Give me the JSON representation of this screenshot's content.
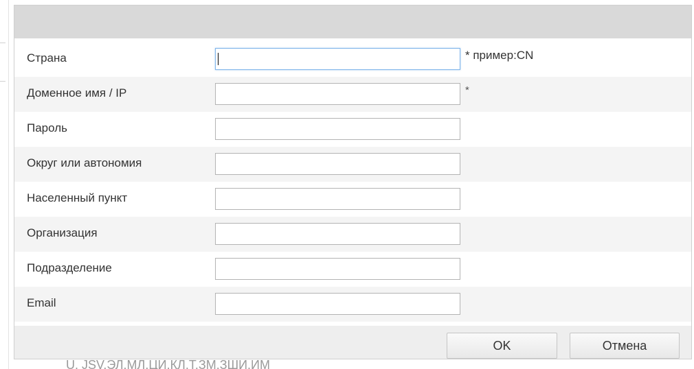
{
  "background": {
    "partial_text": "U. JSV.ЭЛ.МЛ.ЦИ.КЛ.Т.ЗМ.ЗШИ.ИМ"
  },
  "dialog": {
    "fields": [
      {
        "label": "Страна",
        "value": "",
        "note": "* пример:CN",
        "focused": true
      },
      {
        "label": "Доменное имя / IP",
        "value": "",
        "note": "*"
      },
      {
        "label": "Пароль",
        "value": "",
        "note": ""
      },
      {
        "label": "Округ или автономия",
        "value": "",
        "note": ""
      },
      {
        "label": "Населенный пункт",
        "value": "",
        "note": ""
      },
      {
        "label": "Организация",
        "value": "",
        "note": ""
      },
      {
        "label": "Подразделение",
        "value": "",
        "note": ""
      },
      {
        "label": "Email",
        "value": "",
        "note": ""
      }
    ],
    "buttons": {
      "ok_label": "OK",
      "cancel_label": "Отмена"
    }
  },
  "colors": {
    "header_bg": "#d9d9d9",
    "row_alt_bg": "#f4f4f4",
    "footer_bg": "#eeeeee",
    "focus_border": "#7eb4ea"
  }
}
